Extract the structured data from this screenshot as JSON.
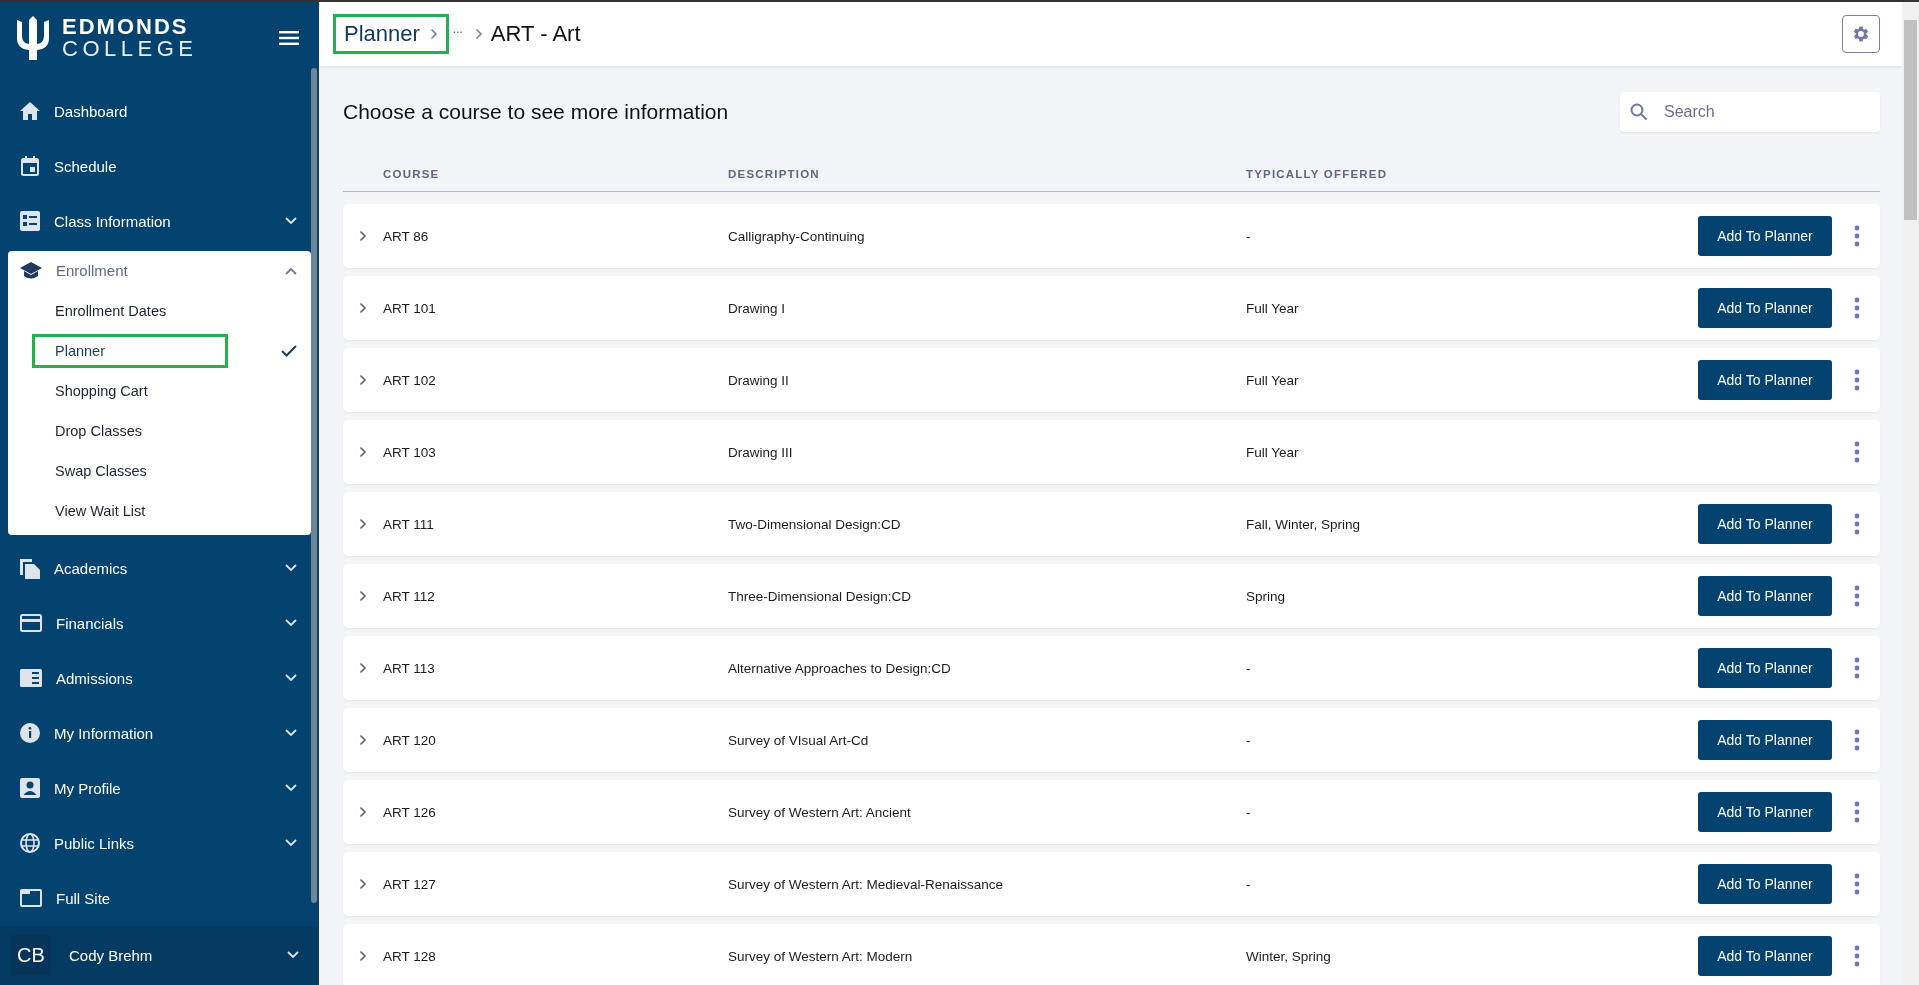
{
  "sidebar": {
    "logo": {
      "line_1": "EDMONDS",
      "line_2": "COLLEGE"
    },
    "items": [
      {
        "kind": "link",
        "label": "Dashboard"
      },
      {
        "kind": "link",
        "label": "Schedule"
      },
      {
        "kind": "group",
        "label": "Class Information",
        "expanded": false
      },
      {
        "kind": "group",
        "label": "Enrollment",
        "expanded": true,
        "children": [
          {
            "label": "Enrollment Dates",
            "selected": false,
            "highlighted": false
          },
          {
            "label": "Planner",
            "selected": true,
            "highlighted": true
          },
          {
            "label": "Shopping Cart",
            "selected": false,
            "highlighted": false
          },
          {
            "label": "Drop Classes",
            "selected": false,
            "highlighted": false
          },
          {
            "label": "Swap Classes",
            "selected": false,
            "highlighted": false
          },
          {
            "label": "View Wait List",
            "selected": false,
            "highlighted": false
          }
        ]
      },
      {
        "kind": "group",
        "label": "Academics",
        "expanded": false
      },
      {
        "kind": "group",
        "label": "Financials",
        "expanded": false
      },
      {
        "kind": "group",
        "label": "Admissions",
        "expanded": false
      },
      {
        "kind": "group",
        "label": "My Information",
        "expanded": false
      },
      {
        "kind": "group",
        "label": "My Profile",
        "expanded": false
      },
      {
        "kind": "group",
        "label": "Public Links",
        "expanded": false
      },
      {
        "kind": "link",
        "label": "Full Site"
      }
    ],
    "user": {
      "initials": "CB",
      "name": "Cody Brehm"
    }
  },
  "breadcrumb": {
    "items": [
      {
        "label": "Planner",
        "highlighted": true
      },
      {
        "label": "..."
      }
    ],
    "current": "ART - Art"
  },
  "heading": "Choose a course to see more information",
  "search": {
    "placeholder": "Search"
  },
  "table": {
    "columns": [
      "COURSE",
      "DESCRIPTION",
      "TYPICALLY OFFERED"
    ],
    "rows": [
      {
        "course": "ART 86",
        "description": "Calligraphy-Continuing",
        "offered": "-",
        "button": "Add To Planner"
      },
      {
        "course": "ART 101",
        "description": "Drawing I",
        "offered": "Full Year",
        "button": "Add To Planner"
      },
      {
        "course": "ART 102",
        "description": "Drawing II",
        "offered": "Full Year",
        "button": "Add To Planner"
      },
      {
        "course": "ART 103",
        "description": "Drawing III",
        "offered": "Full Year"
      },
      {
        "course": "ART 111",
        "description": "Two-Dimensional Design:CD",
        "offered": "Fall, Winter, Spring",
        "button": "Add To Planner"
      },
      {
        "course": "ART 112",
        "description": "Three-Dimensional Design:CD",
        "offered": "Spring",
        "button": "Add To Planner"
      },
      {
        "course": "ART 113",
        "description": "Alternative Approaches to Design:CD",
        "offered": "-",
        "button": "Add To Planner"
      },
      {
        "course": "ART 120",
        "description": "Survey of VIsual Art-Cd",
        "offered": "-",
        "button": "Add To Planner"
      },
      {
        "course": "ART 126",
        "description": "Survey of Western Art: Ancient",
        "offered": "-",
        "button": "Add To Planner"
      },
      {
        "course": "ART 127",
        "description": "Survey of Western Art: Medieval-Renaissance",
        "offered": "-",
        "button": "Add To Planner"
      },
      {
        "course": "ART 128",
        "description": "Survey of Western Art: Modern",
        "offered": "Winter, Spring",
        "button": "Add To Planner"
      }
    ]
  }
}
